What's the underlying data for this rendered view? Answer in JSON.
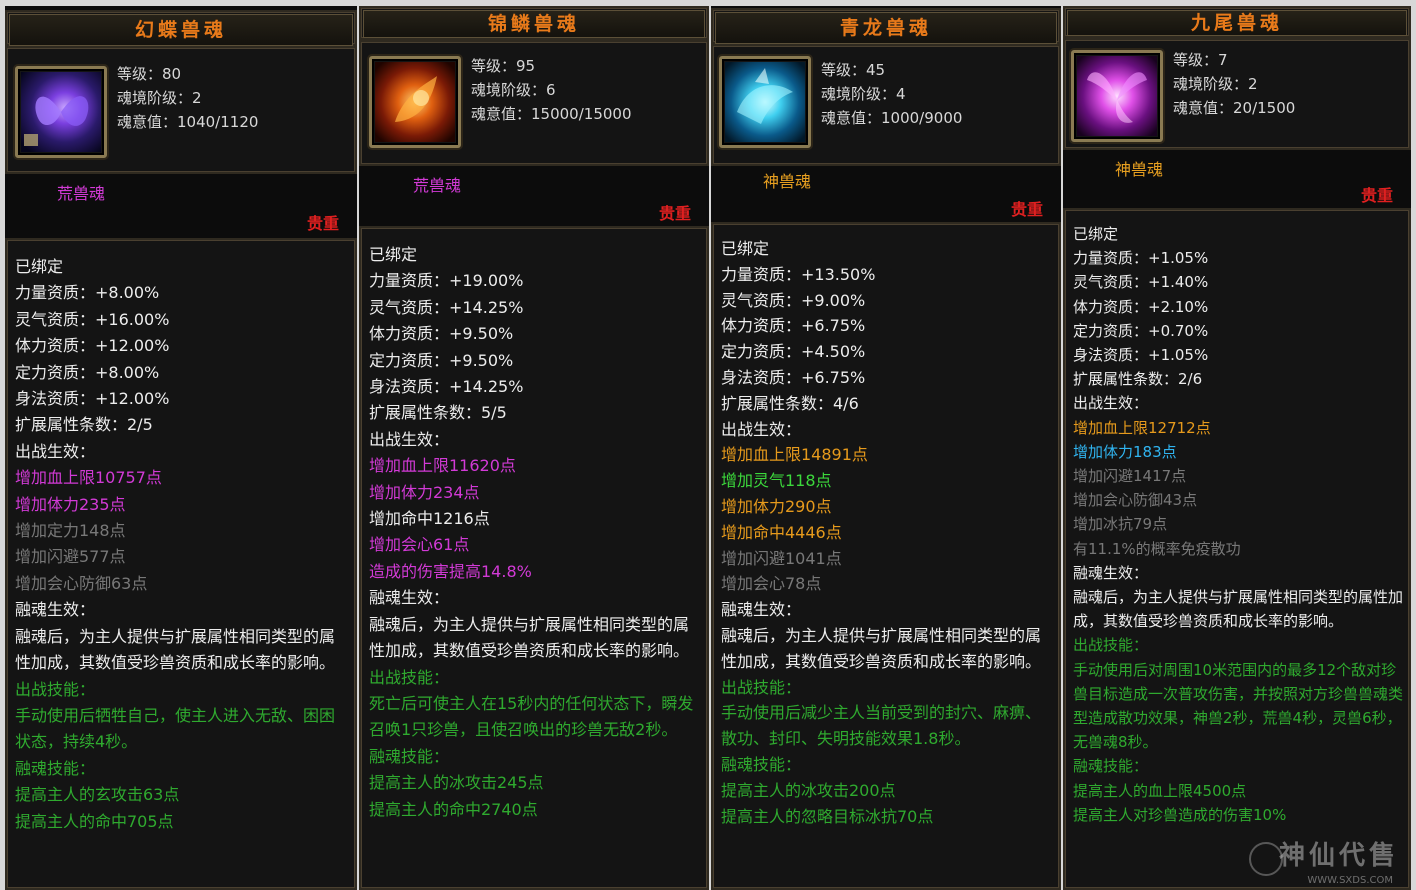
{
  "panels": [
    {
      "title": "幻蝶兽魂",
      "level": "等级：80",
      "realm": "魂境阶级：2",
      "soul": "魂意值：1040/1120",
      "type": "荒兽魂",
      "rarity": "贵重",
      "bound": "已绑定",
      "attrs": [
        "力量资质：+8.00%",
        "灵气资质：+16.00%",
        "体力资质：+12.00%",
        "定力资质：+8.00%",
        "身法资质：+12.00%",
        "扩展属性条数：2/5",
        "出战生效："
      ],
      "battle": [
        {
          "text": "增加血上限10757点",
          "cls": "p"
        },
        {
          "text": "增加体力235点",
          "cls": "p"
        },
        {
          "text": "增加定力148点",
          "cls": "g"
        },
        {
          "text": "增加闪避577点",
          "cls": "g"
        },
        {
          "text": "增加会心防御63点",
          "cls": "g"
        }
      ],
      "fuse_label": "融魂生效：",
      "fuse_text": "融魂后，为主人提供与扩展属性相同类型的属性加成，其数值受珍兽资质和成长率的影响。",
      "skill_label": "出战技能：",
      "skill_text": "手动使用后牺牲自己，使主人进入无敌、困困状态，持续4秒。",
      "fskill_label": "融魂技能：",
      "fskills": [
        "提高主人的玄攻击63点",
        "提高主人的命中705点"
      ]
    },
    {
      "title": "锦鳞兽魂",
      "level": "等级：95",
      "realm": "魂境阶级：6",
      "soul": "魂意值：15000/15000",
      "type": "荒兽魂",
      "rarity": "贵重",
      "bound": "已绑定",
      "attrs": [
        "力量资质：+19.00%",
        "灵气资质：+14.25%",
        "体力资质：+9.50%",
        "定力资质：+9.50%",
        "身法资质：+14.25%",
        "扩展属性条数：5/5",
        "出战生效："
      ],
      "battle": [
        {
          "text": "增加血上限11620点",
          "cls": "p"
        },
        {
          "text": "增加体力234点",
          "cls": "p"
        },
        {
          "text": "增加命中1216点",
          "cls": "w"
        },
        {
          "text": "增加会心61点",
          "cls": "p"
        },
        {
          "text": "造成的伤害提高14.8%",
          "cls": "p"
        }
      ],
      "fuse_label": "融魂生效：",
      "fuse_text": "融魂后，为主人提供与扩展属性相同类型的属性加成，其数值受珍兽资质和成长率的影响。",
      "skill_label": "出战技能：",
      "skill_text": "死亡后可使主人在15秒内的任何状态下，瞬发召唤1只珍兽，且使召唤出的珍兽无敌2秒。",
      "fskill_label": "融魂技能：",
      "fskills": [
        "提高主人的冰攻击245点",
        "提高主人的命中2740点"
      ]
    },
    {
      "title": "青龙兽魂",
      "level": "等级：45",
      "realm": "魂境阶级：4",
      "soul": "魂意值：1000/9000",
      "type": "神兽魂",
      "rarity": "贵重",
      "bound": "已绑定",
      "attrs": [
        "力量资质：+13.50%",
        "灵气资质：+9.00%",
        "体力资质：+6.75%",
        "定力资质：+4.50%",
        "身法资质：+6.75%",
        "扩展属性条数：4/6",
        "出战生效："
      ],
      "battle": [
        {
          "text": "增加血上限14891点",
          "cls": "o"
        },
        {
          "text": "增加灵气118点",
          "cls": "lg"
        },
        {
          "text": "增加体力290点",
          "cls": "o"
        },
        {
          "text": "增加命中4446点",
          "cls": "o"
        },
        {
          "text": "增加闪避1041点",
          "cls": "g"
        },
        {
          "text": "增加会心78点",
          "cls": "g"
        }
      ],
      "fuse_label": "融魂生效：",
      "fuse_text": "融魂后，为主人提供与扩展属性相同类型的属性加成，其数值受珍兽资质和成长率的影响。",
      "skill_label": "出战技能：",
      "skill_text": "手动使用后减少主人当前受到的封穴、麻痹、散功、封印、失明技能效果1.8秒。",
      "fskill_label": "融魂技能：",
      "fskills": [
        "提高主人的冰攻击200点",
        "提高主人的忽略目标冰抗70点"
      ]
    },
    {
      "title": "九尾兽魂",
      "level": "等级：7",
      "realm": "魂境阶级：2",
      "soul": "魂意值：20/1500",
      "type": "神兽魂",
      "rarity": "贵重",
      "bound": "已绑定",
      "attrs": [
        "力量资质：+1.05%",
        "灵气资质：+1.40%",
        "体力资质：+2.10%",
        "定力资质：+0.70%",
        "身法资质：+1.05%",
        "扩展属性条数：2/6",
        "出战生效："
      ],
      "battle": [
        {
          "text": "增加血上限12712点",
          "cls": "o"
        },
        {
          "text": "增加体力183点",
          "cls": "b"
        },
        {
          "text": "增加闪避1417点",
          "cls": "g"
        },
        {
          "text": "增加会心防御43点",
          "cls": "g"
        },
        {
          "text": "增加冰抗79点",
          "cls": "g"
        },
        {
          "text": "有11.1%的概率免疫散功",
          "cls": "g"
        }
      ],
      "fuse_label": "融魂生效：",
      "fuse_text": "融魂后，为主人提供与扩展属性相同类型的属性加成，其数值受珍兽资质和成长率的影响。",
      "skill_label": "出战技能：",
      "skill_text": "手动使用后对周围10米范围内的最多12个敌对珍兽目标造成一次普攻伤害，并按照对方珍兽兽魂类型造成散功效果，神兽2秒，荒兽4秒，灵兽6秒，无兽魂8秒。",
      "fskill_label": "融魂技能：",
      "fskills": [
        "提高主人的血上限4500点",
        "提高主人对珍兽造成的伤害10%"
      ]
    }
  ],
  "watermark": "神仙代售",
  "watermark_url": "WWW.SXDS.COM",
  "colors": {
    "title": "#e87a1a",
    "rarity": "#e02020",
    "purple": "#d23ad6",
    "green": "#2faa2f",
    "orange": "#e69a1c",
    "blue": "#30b4f0"
  }
}
